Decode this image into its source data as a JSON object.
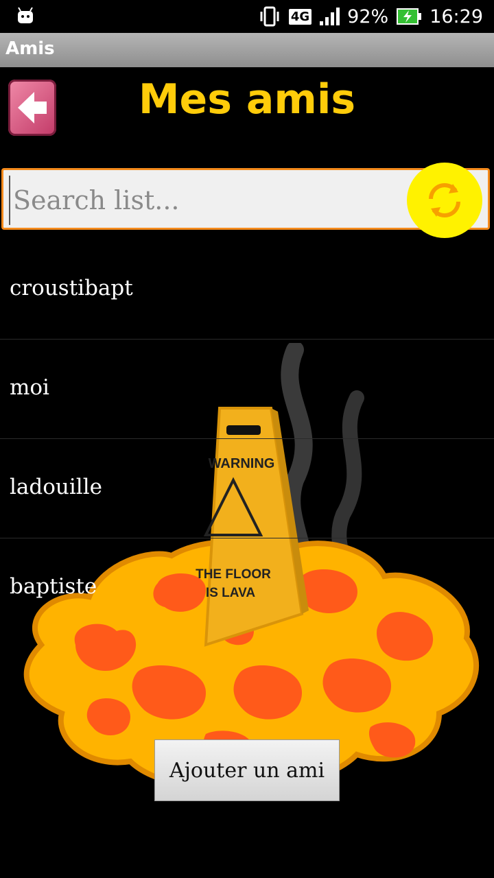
{
  "status_bar": {
    "network": "4G",
    "battery": "92%",
    "time": "16:29"
  },
  "action_bar": {
    "title": "Amis"
  },
  "header": {
    "title": "Mes amis"
  },
  "search": {
    "placeholder": "Search list..."
  },
  "friends": [
    {
      "name": "croustibapt"
    },
    {
      "name": "moi"
    },
    {
      "name": "ladouille"
    },
    {
      "name": "baptiste"
    }
  ],
  "background": {
    "sign_top": "WARNING",
    "sign_bottom_1": "THE FLOOR",
    "sign_bottom_2": "IS LAVA"
  },
  "footer": {
    "add_friend_label": "Ajouter un ami"
  },
  "colors": {
    "title": "#ffcc0a",
    "search_border": "#f48a1c",
    "refresh": "#fff200",
    "lava_orange": "#ff5a1a",
    "lava_yellow": "#ffb300"
  },
  "icons": [
    "android-icon",
    "vibrate-icon",
    "signal-icon",
    "battery-charging-icon",
    "back-arrow-icon",
    "refresh-icon"
  ]
}
